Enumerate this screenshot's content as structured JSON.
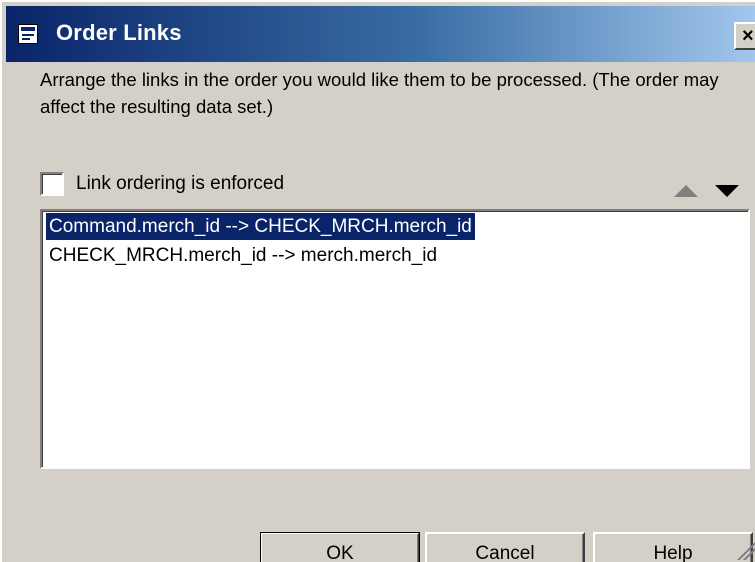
{
  "window": {
    "title": "Order Links",
    "close_label": "×"
  },
  "description": "Arrange the links in the order you would like them to be processed.  (The order may affect the resulting data set.)",
  "enforce": {
    "label": "Link ordering is enforced",
    "checked": false
  },
  "links": [
    {
      "text": "Command.merch_id --> CHECK_MRCH.merch_id",
      "selected": true
    },
    {
      "text": "CHECK_MRCH.merch_id --> merch.merch_id",
      "selected": false
    }
  ],
  "buttons": {
    "ok": "OK",
    "cancel": "Cancel",
    "help": "Help"
  },
  "icons": {
    "window": "app-window-icon",
    "move_up": "move-up-arrow-icon",
    "move_down": "move-down-arrow-icon"
  },
  "colors": {
    "selection": "#0a246a",
    "titlebar_start": "#0a246a",
    "titlebar_end": "#a6caf0",
    "face": "#d4d0c8",
    "disabled_arrow": "#808080"
  }
}
